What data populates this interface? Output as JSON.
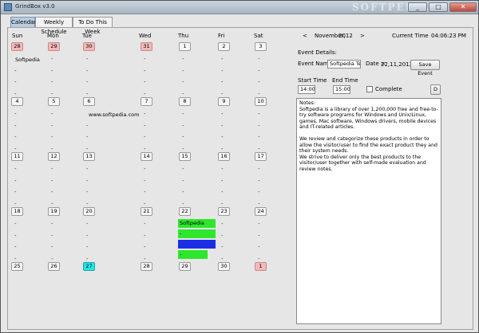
{
  "window": {
    "title": "GrindBox v3.0",
    "watermark": "SOFTPEDIA",
    "min": "_",
    "max": "□",
    "close": "✕"
  },
  "tabs": [
    "Calendar",
    "Weekly Schedule",
    "To Do This Week"
  ],
  "days": [
    "Sun",
    "Mon",
    "Tue",
    "Wed",
    "Thu",
    "Fri",
    "Sat"
  ],
  "weeks": [
    [
      "28",
      "29",
      "30",
      "31",
      "1",
      "2",
      "3"
    ],
    [
      "4",
      "5",
      "6",
      "7",
      "8",
      "9",
      "10"
    ],
    [
      "11",
      "12",
      "13",
      "14",
      "15",
      "16",
      "17"
    ],
    [
      "18",
      "19",
      "20",
      "21",
      "22",
      "23",
      "24"
    ],
    [
      "25",
      "26",
      "27",
      "28",
      "29",
      "30",
      "1"
    ]
  ],
  "entries": {
    "softpedia_sun": "Softpedia",
    "softpedia_tue": "www.softpedia.com",
    "thu22_event": "Softpedia Test",
    "thu22_dash": "-"
  },
  "dot": "-",
  "nav": {
    "prev": "<",
    "month": "November,",
    "year": "2012",
    "next": ">"
  },
  "current_time": {
    "label": "Current Time",
    "value": "04:06:23 PM"
  },
  "event": {
    "details_label": "Event Details:",
    "name_label": "Event Name =",
    "name_value": "Softpedia Tes",
    "date_label": "Date =",
    "date_value": "22,11,2012",
    "save_label": "Save Event",
    "start_label": "Start Time",
    "start_value": "14:00",
    "end_label": "End Time",
    "end_value": "15:00",
    "complete_label": "Complete",
    "d_button": "D"
  },
  "notes": {
    "text": "Notes:\nSoftpedia is a library of over 1,200,000 free and free-to-try software programs for Windows and Unix/Linux, games, Mac software, Windows drivers, mobile devices and IT-related articles.\n\nWe review and categorize these products in order to allow the visitor/user to find the exact product they and their system needs.\nWe strive to deliver only the best products to the visitor/user together with self-made evaluation and review notes."
  },
  "colors": {
    "other_month": "#f5b8b8",
    "today": "#22e6e6",
    "event_green": "#2ee62e",
    "event_blue": "#1a2ee6"
  }
}
